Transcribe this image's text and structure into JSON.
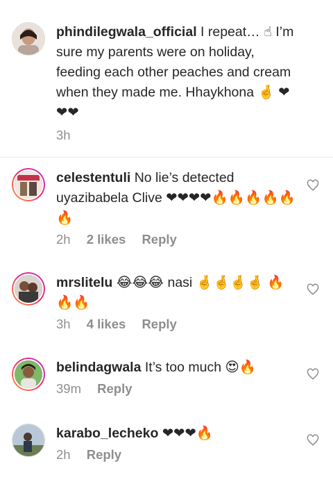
{
  "comments": [
    {
      "username": "phindilegwala_official",
      "text": " I repeat… ☝ I’m sure my parents were on holiday, feeding each other peaches and cream when they made me. Hhaykhona 🤞 ❤❤❤",
      "time": "3h",
      "likes": "",
      "reply": ""
    },
    {
      "username": "celestentuli",
      "text": " No lie’s detected uyazibabela Clive ❤❤❤❤🔥🔥🔥🔥🔥🔥",
      "time": "2h",
      "likes": "2 likes",
      "reply": "Reply"
    },
    {
      "username": "mrslitelu",
      "text": " 😂😂😂 nasi 🤞🤞🤞🤞 🔥🔥🔥",
      "time": "3h",
      "likes": "4 likes",
      "reply": "Reply"
    },
    {
      "username": "belindagwala",
      "text": " It’s too much 😍🔥",
      "time": "39m",
      "likes": "",
      "reply": "Reply"
    },
    {
      "username": "karabo_lecheko",
      "text": " ❤❤❤🔥",
      "time": "2h",
      "likes": "",
      "reply": "Reply"
    }
  ],
  "icons": {
    "like": "heart-outline-icon"
  },
  "colors": {
    "text": "#262626",
    "meta": "#8e8e8e",
    "heart": "#e0223b",
    "fire": "#f07a1a"
  }
}
